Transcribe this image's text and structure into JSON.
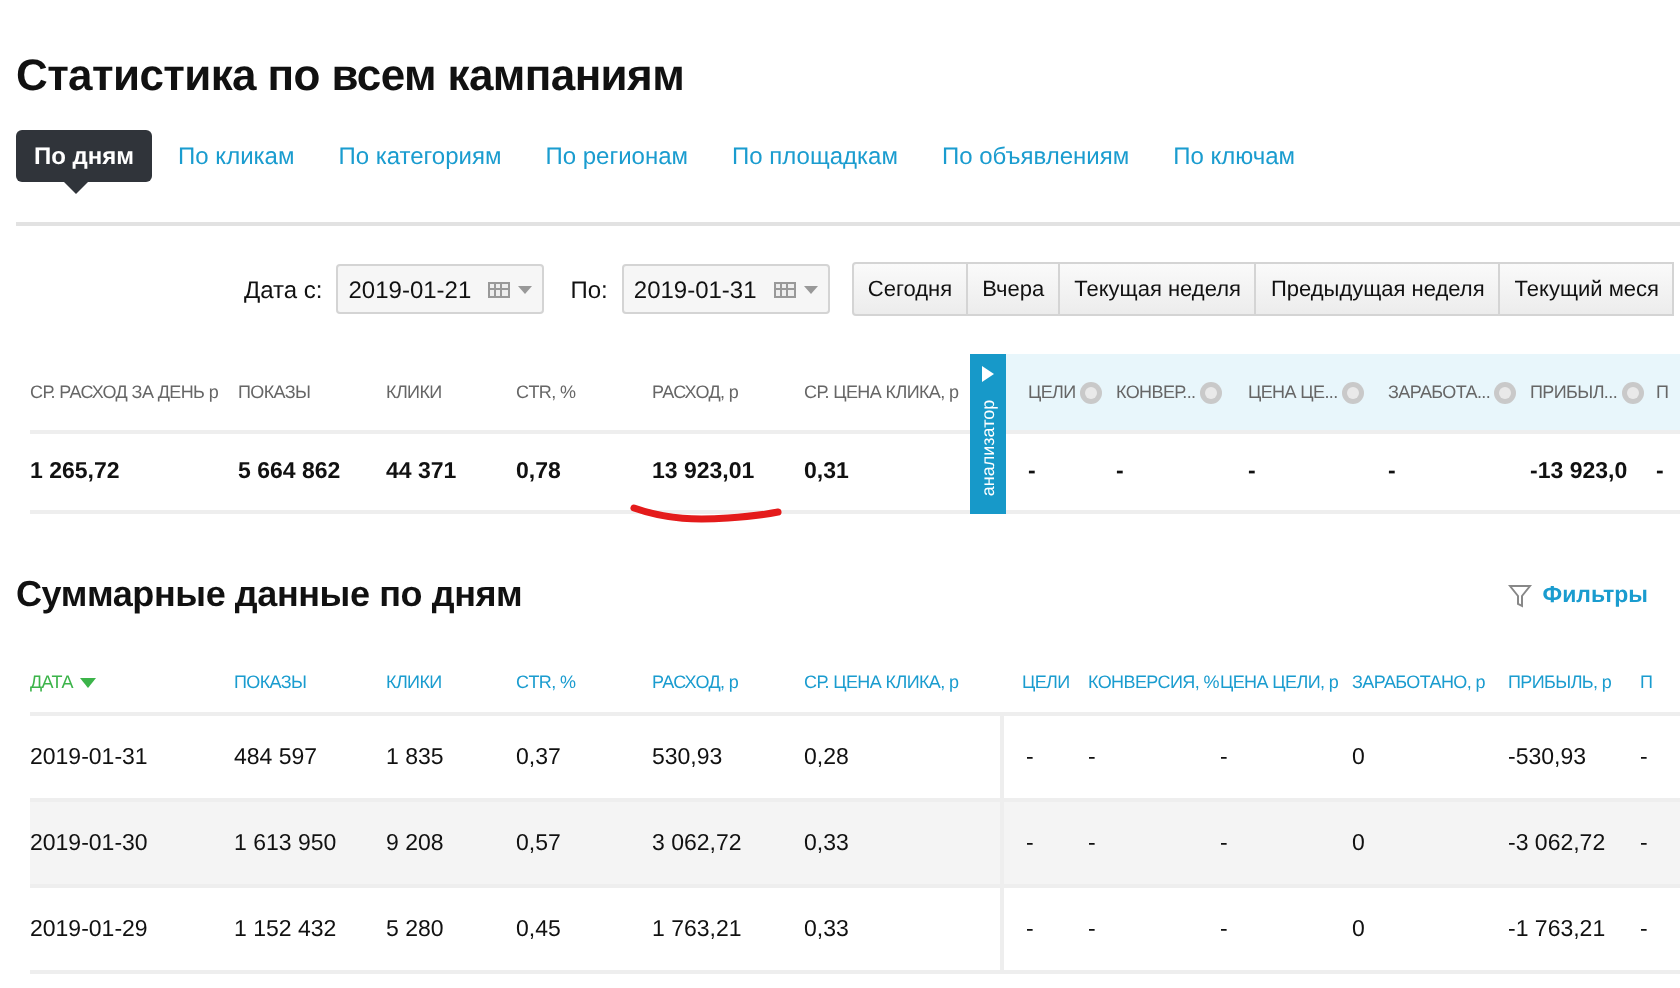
{
  "title": "Статистика по всем кампаниям",
  "tabs": [
    {
      "label": "По дням",
      "selected": true
    },
    {
      "label": "По кликам",
      "selected": false
    },
    {
      "label": "По категориям",
      "selected": false
    },
    {
      "label": "По регионам",
      "selected": false
    },
    {
      "label": "По площадкам",
      "selected": false
    },
    {
      "label": "По объявлениям",
      "selected": false
    },
    {
      "label": "По ключам",
      "selected": false
    }
  ],
  "date_filter": {
    "from_label": "Дата с:",
    "from_value": "2019-01-21",
    "to_label": "По:",
    "to_value": "2019-01-31",
    "presets": [
      "Сегодня",
      "Вчера",
      "Текущая неделя",
      "Предыдущая неделя",
      "Текущий меся"
    ]
  },
  "summary": {
    "analyzer_label": "анализатор",
    "columns": [
      {
        "label": "СР. РАСХОД ЗА ДЕНЬ р",
        "help": false
      },
      {
        "label": "ПОКАЗЫ",
        "help": false
      },
      {
        "label": "КЛИКИ",
        "help": false
      },
      {
        "label": "CTR, %",
        "help": false
      },
      {
        "label": "РАСХОД, р",
        "help": false
      },
      {
        "label": "СР. ЦЕНА КЛИКА, р",
        "help": false
      },
      {
        "label": "ЦЕЛИ",
        "help": true
      },
      {
        "label": "КОНВЕР...",
        "help": true
      },
      {
        "label": "ЦЕНА ЦЕ...",
        "help": true
      },
      {
        "label": "ЗАРАБОТА...",
        "help": true
      },
      {
        "label": "ПРИБЫЛ...",
        "help": true
      },
      {
        "label": "П",
        "help": false
      }
    ],
    "values": [
      "1 265,72",
      "5 664 862",
      "44 371",
      "0,78",
      "13 923,01",
      "0,31",
      "-",
      "-",
      "-",
      "-",
      "-13 923,0",
      "-"
    ]
  },
  "daily": {
    "title": "Суммарные данные по дням",
    "filter_label": "Фильтры",
    "columns": [
      {
        "label": "ДАТА",
        "sorted": true
      },
      {
        "label": "ПОКАЗЫ",
        "sorted": false
      },
      {
        "label": "КЛИКИ",
        "sorted": false
      },
      {
        "label": "CTR, %",
        "sorted": false
      },
      {
        "label": "РАСХОД, р",
        "sorted": false
      },
      {
        "label": "СР. ЦЕНА КЛИКА, р",
        "sorted": false
      },
      {
        "label": "ЦЕЛИ",
        "sorted": false
      },
      {
        "label": "КОНВЕРСИЯ, %",
        "sorted": false
      },
      {
        "label": "ЦЕНА ЦЕЛИ, р",
        "sorted": false
      },
      {
        "label": "ЗАРАБОТАНО, р",
        "sorted": false
      },
      {
        "label": "ПРИБЫЛЬ, р",
        "sorted": false
      },
      {
        "label": "П",
        "sorted": false
      }
    ],
    "rows": [
      [
        "2019-01-31",
        "484 597",
        "1 835",
        "0,37",
        "530,93",
        "0,28",
        "-",
        "-",
        "-",
        "0",
        "-530,93",
        "-"
      ],
      [
        "2019-01-30",
        "1 613 950",
        "9 208",
        "0,57",
        "3 062,72",
        "0,33",
        "-",
        "-",
        "-",
        "0",
        "-3 062,72",
        "-"
      ],
      [
        "2019-01-29",
        "1 152 432",
        "5 280",
        "0,45",
        "1 763,21",
        "0,33",
        "-",
        "-",
        "-",
        "0",
        "-1 763,21",
        "-"
      ]
    ]
  }
}
